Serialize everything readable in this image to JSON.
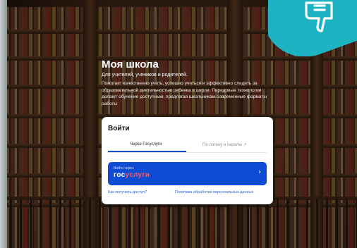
{
  "hero": {
    "title": "Моя школа",
    "subtitle": "Для учителей, учеников и родителей.",
    "description": "Помогает качественно учить, успешно учиться и эффективно следить за образовательной деятельностью ребенка в школе. Передовые технологии делают обучение доступным, предлагая школьникам современные форматы работы"
  },
  "login_card": {
    "title": "Войти",
    "tabs": [
      {
        "label": "Через Госуслуги",
        "active": true
      },
      {
        "label": "По логину и паролю ↗",
        "active": false
      }
    ],
    "gosuslugi_button": {
      "small_label": "Войти через",
      "logo_part1": "гос",
      "logo_part2": "услуги",
      "chevron": "›"
    },
    "links": {
      "access": "Как получить доступ?",
      "policy": "Политика обработки персональных данных"
    }
  },
  "colors": {
    "primary_blue": "#0d4cd3",
    "badge_teal": "#1db3c2",
    "logo_red": "#ff5a5f"
  },
  "icons": {
    "badge_icon": "thumbs-down-icon"
  }
}
